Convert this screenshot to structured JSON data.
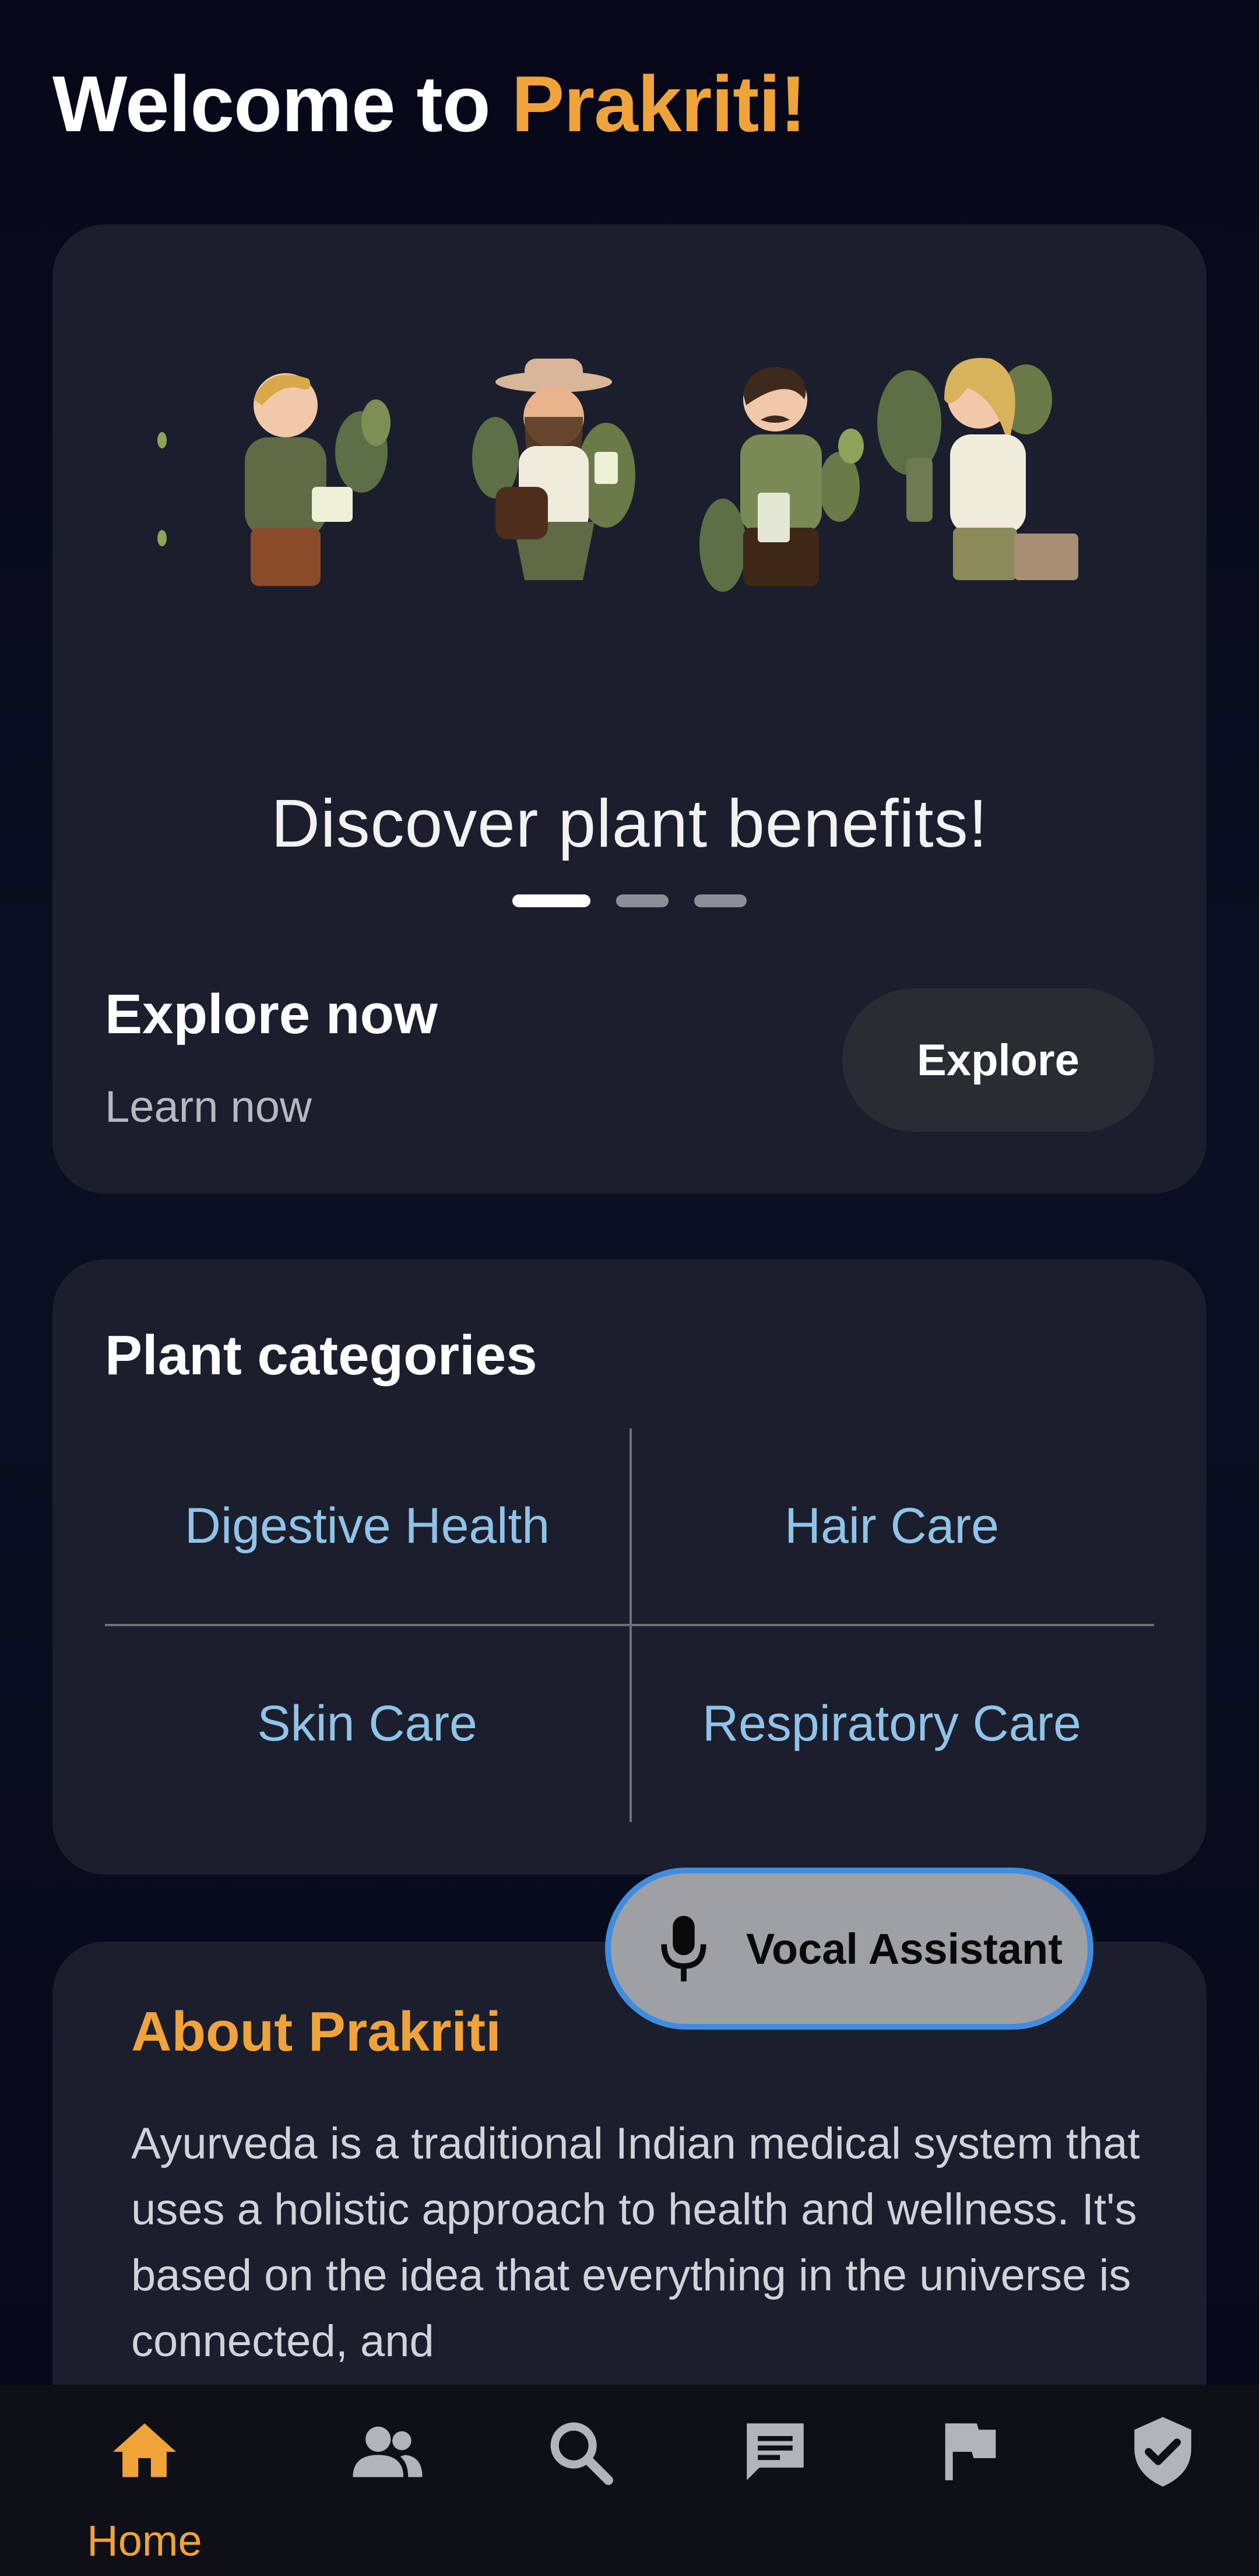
{
  "header": {
    "welcome_prefix": "Welcome to ",
    "brand": "Prakriti!"
  },
  "hero": {
    "caption": "Discover plant benefits!",
    "carousel": {
      "total": 3,
      "active_index": 0
    },
    "explore_title": "Explore now",
    "explore_subtitle": "Learn now",
    "explore_button": "Explore"
  },
  "categories": {
    "title": "Plant categories",
    "items": [
      "Digestive Health",
      "Hair Care",
      "Skin Care",
      "Respiratory Care"
    ]
  },
  "about": {
    "title": "About Prakriti",
    "text": "Ayurveda is a traditional Indian medical system that uses a holistic approach to health and wellness. It's based on the idea that everything in the universe is connected, and"
  },
  "vocal_assistant": {
    "label": "Vocal Assistant",
    "icon": "mic-icon"
  },
  "bottom_nav": {
    "active": "home",
    "items": [
      {
        "id": "home",
        "icon": "home-icon",
        "label": "Home"
      },
      {
        "id": "people",
        "icon": "people-icon"
      },
      {
        "id": "search",
        "icon": "search-icon"
      },
      {
        "id": "chat",
        "icon": "chat-icon"
      },
      {
        "id": "flag",
        "icon": "flag-icon"
      },
      {
        "id": "verified",
        "icon": "verified-shield-icon"
      }
    ]
  },
  "colors": {
    "accent": "#f0a338",
    "link": "#8fc4e8",
    "card": "#1b1e2c",
    "background": "#060a1c",
    "nav_inactive": "#b3b4bb",
    "assistant_border": "#3f8de0"
  }
}
